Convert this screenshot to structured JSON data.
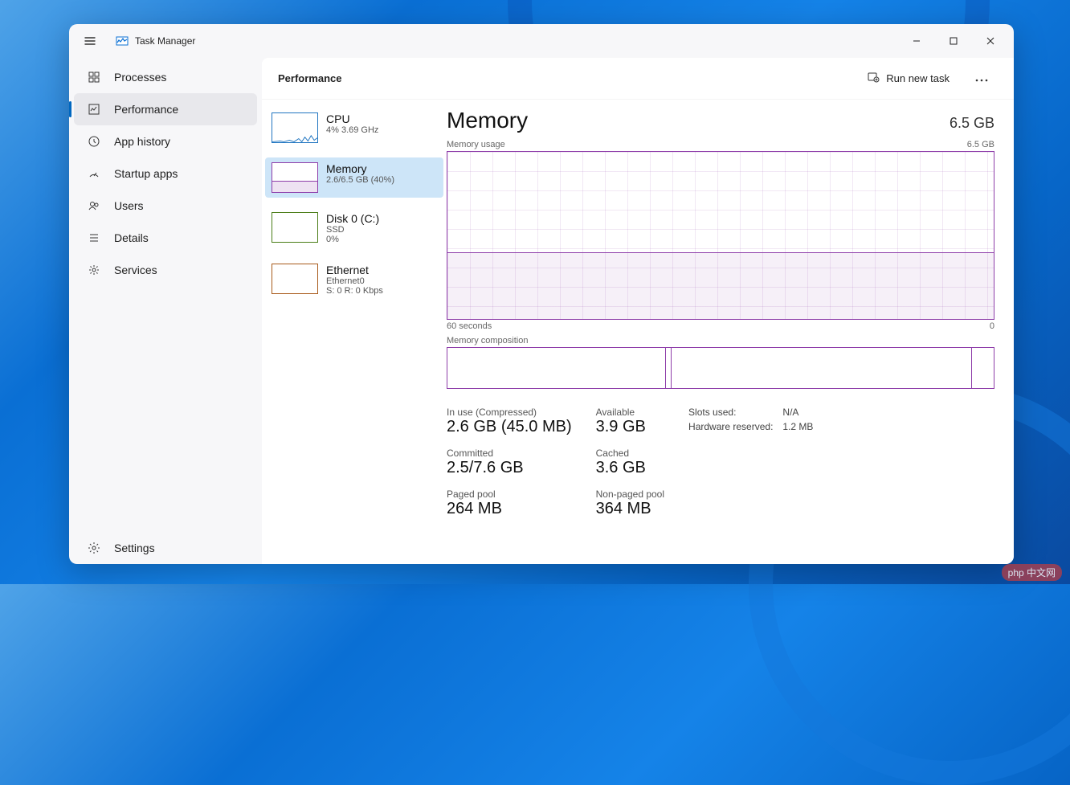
{
  "app": {
    "title": "Task Manager"
  },
  "window_controls": {
    "min": "—",
    "max": "☐",
    "close": "✕"
  },
  "sidebar": {
    "items": [
      {
        "label": "Processes"
      },
      {
        "label": "Performance"
      },
      {
        "label": "App history"
      },
      {
        "label": "Startup apps"
      },
      {
        "label": "Users"
      },
      {
        "label": "Details"
      },
      {
        "label": "Services"
      }
    ],
    "settings_label": "Settings"
  },
  "toolbar": {
    "title": "Performance",
    "run_new_task": "Run new task"
  },
  "perf_tiles": {
    "cpu": {
      "title": "CPU",
      "sub": "4%  3.69 GHz"
    },
    "memory": {
      "title": "Memory",
      "sub": "2.6/6.5 GB (40%)"
    },
    "disk": {
      "title": "Disk 0 (C:)",
      "sub1": "SSD",
      "sub2": "0%"
    },
    "eth": {
      "title": "Ethernet",
      "sub1": "Ethernet0",
      "sub2": "S: 0  R: 0 Kbps"
    }
  },
  "detail": {
    "title": "Memory",
    "capacity": "6.5 GB",
    "usage_label_left": "Memory usage",
    "usage_label_right": "6.5 GB",
    "axis_left": "60 seconds",
    "axis_right": "0",
    "composition_label": "Memory composition",
    "stats": {
      "in_use_label": "In use (Compressed)",
      "in_use_value": "2.6 GB (45.0 MB)",
      "available_label": "Available",
      "available_value": "3.9 GB",
      "committed_label": "Committed",
      "committed_value": "2.5/7.6 GB",
      "cached_label": "Cached",
      "cached_value": "3.6 GB",
      "paged_label": "Paged pool",
      "paged_value": "264 MB",
      "nonpaged_label": "Non-paged pool",
      "nonpaged_value": "364 MB",
      "slots_label": "Slots used:",
      "slots_value": "N/A",
      "hw_label": "Hardware reserved:",
      "hw_value": "1.2 MB"
    }
  },
  "chart_data": {
    "type": "line",
    "title": "Memory usage",
    "xlabel": "60 seconds",
    "ylabel": "",
    "ylim": [
      0,
      6.5
    ],
    "x_range_seconds": [
      60,
      0
    ],
    "series": [
      {
        "name": "Memory usage (GB)",
        "values": [
          2.6,
          2.6,
          2.6,
          2.6,
          2.6,
          2.6,
          2.6,
          2.6,
          2.6,
          2.6,
          2.6,
          2.6
        ]
      }
    ],
    "composition_fractions": {
      "in_use": 0.4,
      "modified": 0.01,
      "standby": 0.55,
      "free": 0.04
    }
  },
  "watermark": "php 中文网"
}
